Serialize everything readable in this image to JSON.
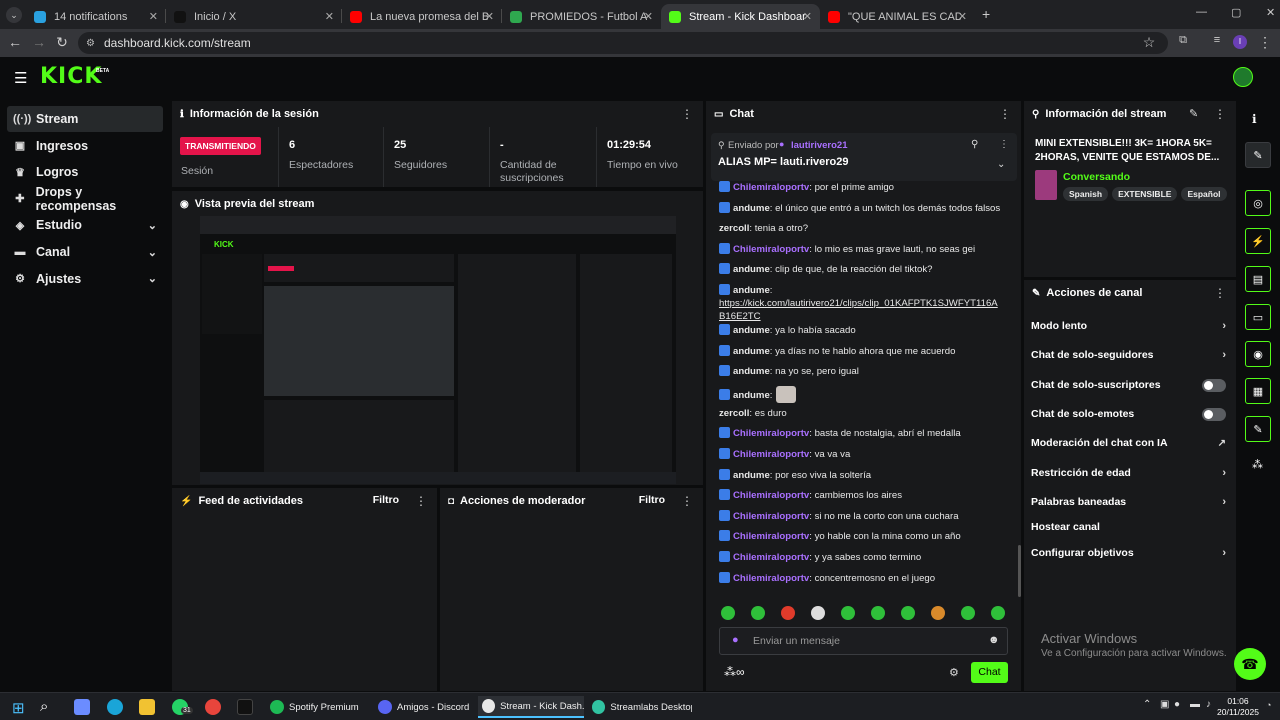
{
  "browser": {
    "tabs": [
      {
        "label": "14 notifications",
        "icon": "telegram-icon",
        "color": "#2aa1e0"
      },
      {
        "label": "Inicio / X",
        "icon": "x-icon",
        "color": "#111111"
      },
      {
        "label": "La nueva promesa del Barça no",
        "icon": "youtube-icon",
        "color": "#ff0000"
      },
      {
        "label": "PROMIEDOS - Futbol Argentino",
        "icon": "promiedos-icon",
        "color": "#2fa84f"
      },
      {
        "label": "Stream - Kick Dashboard",
        "icon": "kick-icon",
        "color": "#53fc18"
      },
      {
        "label": "\"QUE ANIMAL ES CADA JUGAD",
        "icon": "youtube-icon",
        "color": "#ff0000"
      }
    ],
    "url": "dashboard.kick.com/stream"
  },
  "app": {
    "logo": "KICK",
    "logo_tag": "BETA",
    "accent": "#53fc18"
  },
  "sidebar": {
    "items": [
      {
        "label": "Stream",
        "icon": "stream-icon",
        "active": true
      },
      {
        "label": "Ingresos",
        "icon": "money-icon"
      },
      {
        "label": "Logros",
        "icon": "trophy-icon"
      },
      {
        "label": "Drops y recompensas",
        "icon": "gift-icon"
      },
      {
        "label": "Estudio",
        "icon": "studio-icon",
        "expandable": true
      },
      {
        "label": "Canal",
        "icon": "channel-icon",
        "expandable": true
      },
      {
        "label": "Ajustes",
        "icon": "settings-icon",
        "expandable": true
      }
    ]
  },
  "session": {
    "title": "Información de la sesión",
    "status": "TRANSMITIENDO",
    "status_label": "Sesión",
    "stats": [
      {
        "value": "6",
        "label": "Espectadores"
      },
      {
        "value": "25",
        "label": "Seguidores"
      },
      {
        "value": "-",
        "label": "Cantidad de suscripciones"
      },
      {
        "value": "01:29:54",
        "label": "Tiempo en vivo"
      }
    ]
  },
  "preview": {
    "title": "Vista previa del stream"
  },
  "activity": {
    "title": "Feed de actividades",
    "filter": "Filtro"
  },
  "moderator": {
    "title": "Acciones de moderador",
    "filter": "Filtro"
  },
  "chat": {
    "title": "Chat",
    "pinned_prefix": "Enviado por",
    "pinned_user": "lautirivero21",
    "pinned_message": "ALIAS MP= lauti.rivero29",
    "messages": [
      {
        "user": "Chilemiraloportv",
        "text": ": por el prime amigo",
        "style": "u1"
      },
      {
        "user": "andume",
        "text": ": el único que entró a un twitch los demás todos falsos",
        "style": "u2"
      },
      {
        "user": "zercoll",
        "text": ": tenia a otro?",
        "style": "u3",
        "no_badge": true
      },
      {
        "user": "Chilemiraloportv",
        "text": ": lo mio es mas grave lauti, no seas gei",
        "style": "u1"
      },
      {
        "user": "andume",
        "text": ": clip de que, de la reacción del tiktok?",
        "style": "u2"
      },
      {
        "user": "andume",
        "text": ":",
        "style": "u2",
        "link": "https://kick.com/lautirivero21/clips/clip_01KAFPTK1SJWFYT116AB16E2TC"
      },
      {
        "user": "andume",
        "text": ": ya lo había sacado",
        "style": "u2"
      },
      {
        "user": "andume",
        "text": ": ya días no te hablo ahora que me acuerdo",
        "style": "u2"
      },
      {
        "user": "andume",
        "text": ": na yo se, pero igual",
        "style": "u2"
      },
      {
        "user": "andume",
        "text": ":",
        "style": "u2",
        "emote": true
      },
      {
        "user": "zercoll",
        "text": ": es duro",
        "style": "u3",
        "no_badge": true
      },
      {
        "user": "Chilemiraloportv",
        "text": ": basta de nostalgia, abrí el medalla",
        "style": "u1"
      },
      {
        "user": "Chilemiraloportv",
        "text": ": va va va",
        "style": "u1"
      },
      {
        "user": "andume",
        "text": ": por eso viva la soltería",
        "style": "u2"
      },
      {
        "user": "Chilemiraloportv",
        "text": ": cambiemos los aires",
        "style": "u1"
      },
      {
        "user": "Chilemiraloportv",
        "text": ": si no me la corto con una cuchara",
        "style": "u1"
      },
      {
        "user": "Chilemiraloportv",
        "text": ": yo hable con la mina como un año",
        "style": "u1"
      },
      {
        "user": "Chilemiraloportv",
        "text": ": y ya sabes como termino",
        "style": "u1"
      },
      {
        "user": "Chilemiraloportv",
        "text": ": concentremosno en el juego",
        "style": "u1"
      }
    ],
    "input_placeholder": "Enviar un mensaje",
    "send_label": "Chat"
  },
  "stream_info": {
    "title": "Información del stream",
    "stream_title": "MINI EXTENSIBLE!!! 3K= 1HORA 5K= 2HORAS, VENITE QUE ESTAMOS DE...",
    "category": "Conversando",
    "tags": [
      "Spanish",
      "EXTENSIBLE",
      "Español"
    ]
  },
  "channel_actions": {
    "title": "Acciones de canal",
    "items": [
      {
        "label": "Modo lento",
        "control": "chevron"
      },
      {
        "label": "Chat de solo-seguidores",
        "control": "chevron"
      },
      {
        "label": "Chat de solo-suscriptores",
        "control": "toggle"
      },
      {
        "label": "Chat de solo-emotes",
        "control": "toggle"
      },
      {
        "label": "Moderación del chat con IA",
        "control": "external"
      },
      {
        "label": "Restricción de edad",
        "control": "chevron"
      },
      {
        "label": "Palabras baneadas",
        "control": "chevron"
      },
      {
        "label": "Hostear canal",
        "control": "none"
      },
      {
        "label": "Configurar objetivos",
        "control": "chevron"
      }
    ]
  },
  "watermark": {
    "title": "Activar Windows",
    "subtitle": "Ve a Configuración para activar Windows."
  },
  "taskbar": {
    "apps": [
      {
        "label": "Spotify Premium",
        "color": "#1db954"
      },
      {
        "label": "Amigos - Discord",
        "color": "#5865f2"
      },
      {
        "label": "Stream - Kick Dash...",
        "color": "#e8e8e8"
      },
      {
        "label": "Streamlabs Desktop",
        "color": "#31c3a2"
      }
    ],
    "whatsapp_badge": "31",
    "time": "01:06",
    "date": "20/11/2025"
  }
}
